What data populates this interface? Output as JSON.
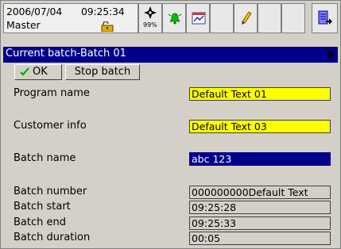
{
  "status": {
    "date": "2006/07/04",
    "time": "09:25:34",
    "user": "Master",
    "memory_percent": "99%",
    "icons": [
      "lock-icon",
      "compass-icon",
      "alarm-bell-icon",
      "calendar-icon",
      "pencil-icon",
      "exit-door-icon"
    ]
  },
  "titlebar": {
    "title": "Current batch-Batch 01"
  },
  "toolbar": {
    "ok_label": "OK",
    "stop_label": "Stop batch"
  },
  "form": {
    "program_name_label": "Program name",
    "program_name_value": "Default Text 01",
    "customer_info_label": "Customer info",
    "customer_info_value": "Default Text 03",
    "batch_name_label": "Batch name",
    "batch_name_value": "abc 123",
    "batch_number_label": "Batch number",
    "batch_number_value": "000000000Default Text",
    "batch_start_label": "Batch start",
    "batch_start_value": "09:25:28",
    "batch_end_label": "Batch end",
    "batch_end_value": "09:25:33",
    "batch_duration_label": "Batch duration",
    "batch_duration_value": "00:05"
  },
  "colors": {
    "titlebar": "#00008b",
    "highlight_field": "#ffff00",
    "selected_field": "#00008b",
    "window_bg": "#d4d0c8"
  }
}
